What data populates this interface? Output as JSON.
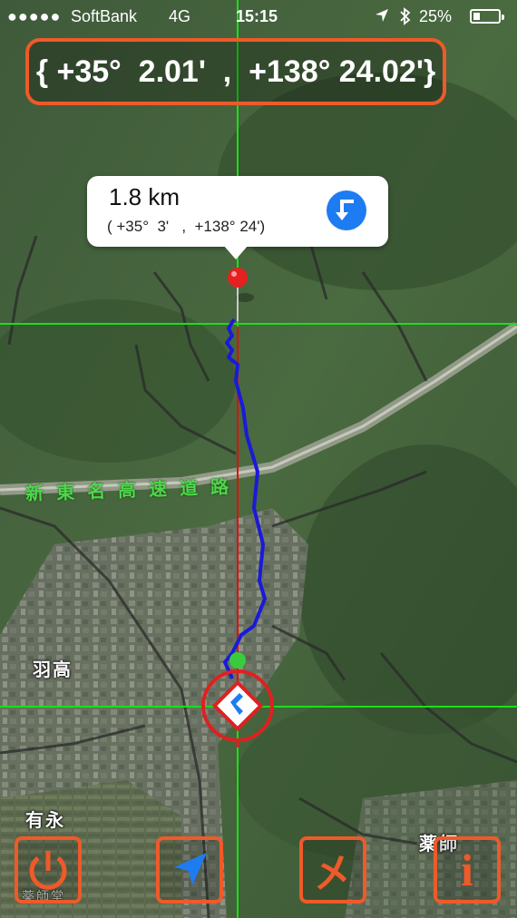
{
  "status_bar": {
    "signal": "●●●●●",
    "carrier": "SoftBank",
    "network": "4G",
    "time": "15:15",
    "battery": "25%",
    "icons": [
      "location-arrow-icon",
      "bluetooth-icon",
      "battery-icon"
    ]
  },
  "coordinates_display": "{ +35°  2.01'  ,  +138° 24.02'}",
  "callout": {
    "distance": "1.8 km",
    "coords": "( +35°  3'   ,  +138° 24')",
    "button_icon": "turn-left-arrow-icon",
    "button_color": "#1e7cf2"
  },
  "map": {
    "place_labels": [
      "羽高",
      "有永",
      "薬師",
      "薬師堂"
    ],
    "expressway_label": "新東名高速道路",
    "crosshair_color": "#19e019",
    "route_color": "#1a1ad8",
    "bearing_line_color": "#e01010",
    "destination_pin_color": "#e52020",
    "current_position_color": "#e02020"
  },
  "toolbar": {
    "accent_color": "#ee5a2a",
    "buttons": [
      {
        "icon": "power-icon"
      },
      {
        "icon": "navigation-arrow-icon"
      },
      {
        "icon": "crossed-tools-icon",
        "glyph": "㐅"
      },
      {
        "icon": "info-icon",
        "glyph": "i"
      }
    ]
  }
}
